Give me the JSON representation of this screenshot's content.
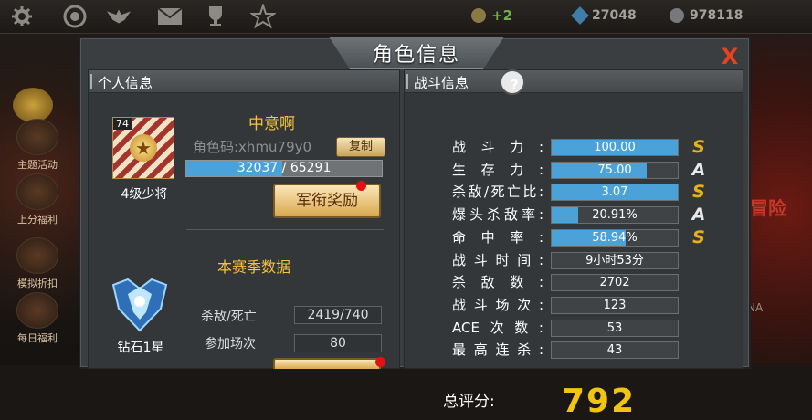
{
  "topbar": {
    "icons": [
      "gear-icon",
      "medal-icon",
      "wings-badge-icon",
      "mail-icon",
      "trophy-icon",
      "star-emblem-icon"
    ],
    "gold_badge": "+2",
    "diamonds": "27048",
    "silver": "978118"
  },
  "side_menu": {
    "items": [
      "主题活动",
      "上分福利",
      "模拟折扣",
      "每日福利"
    ]
  },
  "right_edge": {
    "text1": "冒险",
    "text2": "NA"
  },
  "panel": {
    "title": "角色信息",
    "close_label": "X"
  },
  "personal": {
    "header": "个人信息",
    "level_tag": "74",
    "rank_name": "4级少将",
    "player_name": "中意啊",
    "role_code": "角色码:xhmu79y0",
    "copy_label": "复制",
    "exp_current": "32037",
    "exp_total": "65291",
    "exp_fraction": 0.49,
    "reward_label": "军衔奖励",
    "season_title": "本赛季数据",
    "tier_name": "钻石1星",
    "season_stats": [
      {
        "label": "杀敌/死亡",
        "value": "2419/740"
      },
      {
        "label": "参加场次",
        "value": "80"
      }
    ]
  },
  "battle": {
    "header": "战斗信息",
    "help_label": "?",
    "rated_stats": [
      {
        "label": "战斗力:",
        "value": "100.00",
        "fill": 1.0,
        "grade": "S"
      },
      {
        "label": "生存力:",
        "value": "75.00",
        "fill": 0.75,
        "grade": "A"
      },
      {
        "label": "杀敌/死亡比:",
        "value": "3.07",
        "fill": 1.0,
        "grade": "S"
      },
      {
        "label": "爆头杀敌率:",
        "value": "20.91%",
        "fill": 0.21,
        "grade": "A"
      },
      {
        "label": "命中率:",
        "value": "58.94%",
        "fill": 0.59,
        "grade": "S"
      }
    ],
    "plain_stats": [
      {
        "label": "战斗时间:",
        "value": "9小时53分"
      },
      {
        "label": "杀敌数:",
        "value": "2702"
      },
      {
        "label": "战斗场次:",
        "value": "123"
      },
      {
        "label": "ACE次数:",
        "value": "53"
      },
      {
        "label": "最高连杀:",
        "value": "43"
      }
    ],
    "total_label": "总评分:",
    "total_value": "792"
  },
  "colors": {
    "accent_gold": "#f4c53b",
    "bar_blue": "#4aa2d9",
    "grade_s": "#e5b21f",
    "close_red": "#e5431f"
  }
}
